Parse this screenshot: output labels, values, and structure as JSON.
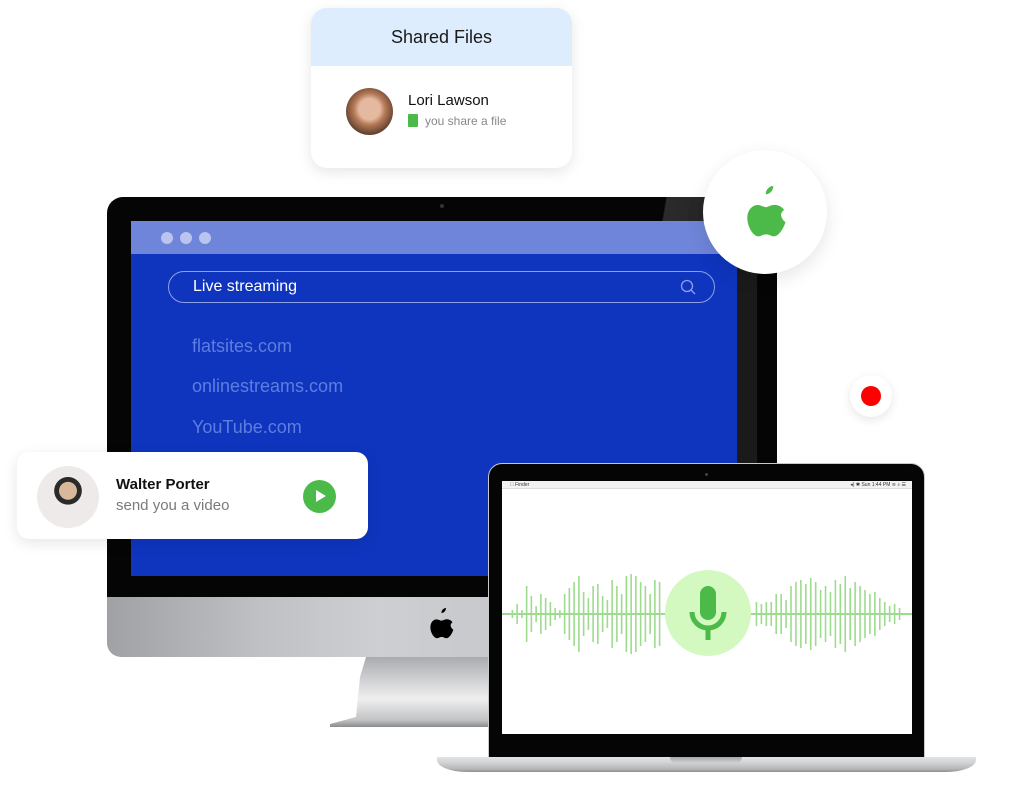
{
  "shared_files_card": {
    "title": "Shared Files",
    "user_name": "Lori Lawson",
    "activity": "you share a file",
    "icon": "file-icon"
  },
  "imac": {
    "browser": {
      "window_controls": [
        "dot",
        "dot",
        "dot"
      ],
      "search_value": "Live streaming",
      "search_icon": "search-icon",
      "suggestions": [
        "flatsites.com",
        "onlinestreams.com",
        "YouTube.com"
      ]
    },
    "logo": "apple-logo-icon"
  },
  "video_card": {
    "user_name": "Walter Porter",
    "activity": "send you a video",
    "action_icon": "play-icon"
  },
  "apple_badge": {
    "icon": "apple-logo-icon",
    "color": "#4cba48"
  },
  "record_badge": {
    "icon": "record-icon",
    "color": "#ff0000"
  },
  "laptop": {
    "menubar": {
      "app_name": "Finder",
      "clock": "Sun 1:44 PM"
    },
    "voice": {
      "icon": "microphone-icon",
      "accent": "#4cba48",
      "wave_color": "#9ddc8e",
      "wave_left": [
        0.1,
        0.25,
        0.1,
        0.7,
        0.45,
        0.2,
        0.5,
        0.4,
        0.3,
        0.15,
        0.1,
        0.5,
        0.65,
        0.8,
        0.95,
        0.55,
        0.4,
        0.7,
        0.75,
        0.45,
        0.35,
        0.85,
        0.7,
        0.5,
        0.95,
        1.0,
        0.95,
        0.8,
        0.7,
        0.5,
        0.85,
        0.8
      ],
      "wave_right": [
        0.3,
        0.25,
        0.3,
        0.3,
        0.5,
        0.5,
        0.35,
        0.7,
        0.8,
        0.85,
        0.75,
        0.9,
        0.8,
        0.6,
        0.7,
        0.55,
        0.85,
        0.75,
        0.95,
        0.65,
        0.8,
        0.7,
        0.6,
        0.5,
        0.55,
        0.4,
        0.3,
        0.2,
        0.25,
        0.15
      ]
    }
  }
}
